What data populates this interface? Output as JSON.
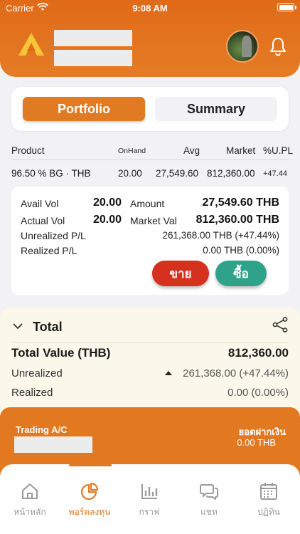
{
  "status": {
    "carrier": "Carrier",
    "time": "9:08 AM"
  },
  "tabs": {
    "portfolio": "Portfolio",
    "summary": "Summary"
  },
  "table": {
    "headers": {
      "product": "Product",
      "onhand": "OnHand",
      "avg": "Avg",
      "market": "Market",
      "upl": "%U.PL"
    },
    "row": {
      "product": "96.50 % BG · THB",
      "onhand": "20.00",
      "avg": "27,549.60",
      "market": "812,360.00",
      "upl": "+47.44"
    }
  },
  "detail": {
    "avail_vol_label": "Avail Vol",
    "avail_vol": "20.00",
    "amount_label": "Amount",
    "amount": "27,549.60 THB",
    "actual_vol_label": "Actual Vol",
    "actual_vol": "20.00",
    "market_val_label": "Market Val",
    "market_val": "812,360.00 THB",
    "unrealized_label": "Unrealized P/L",
    "unrealized": "261,368.00 THB (+47.44%)",
    "realized_label": "Realized P/L",
    "realized": "0.00 THB (0.00%)",
    "sell_label": "ขาย",
    "buy_label": "ซื้อ"
  },
  "total": {
    "title": "Total",
    "value_label": "Total Value (THB)",
    "value": "812,360.00",
    "unrealized_label": "Unrealized",
    "unrealized": "261,368.00 (+47.44%)",
    "realized_label": "Realized",
    "realized": "0.00 (0.00%)"
  },
  "trading": {
    "label": "Trading A/C",
    "deposit_label": "ยอดฝากเงิน",
    "deposit_value": "0.00 THB"
  },
  "nav": {
    "home": "หน้าหลัก",
    "portfolio": "พอร์ตลงทุน",
    "graph": "กราฟ",
    "chat": "แชท",
    "calendar": "ปฏิทิน"
  },
  "colors": {
    "brand": "#e07a23",
    "sell": "#d6311e",
    "buy": "#2ea38a"
  }
}
